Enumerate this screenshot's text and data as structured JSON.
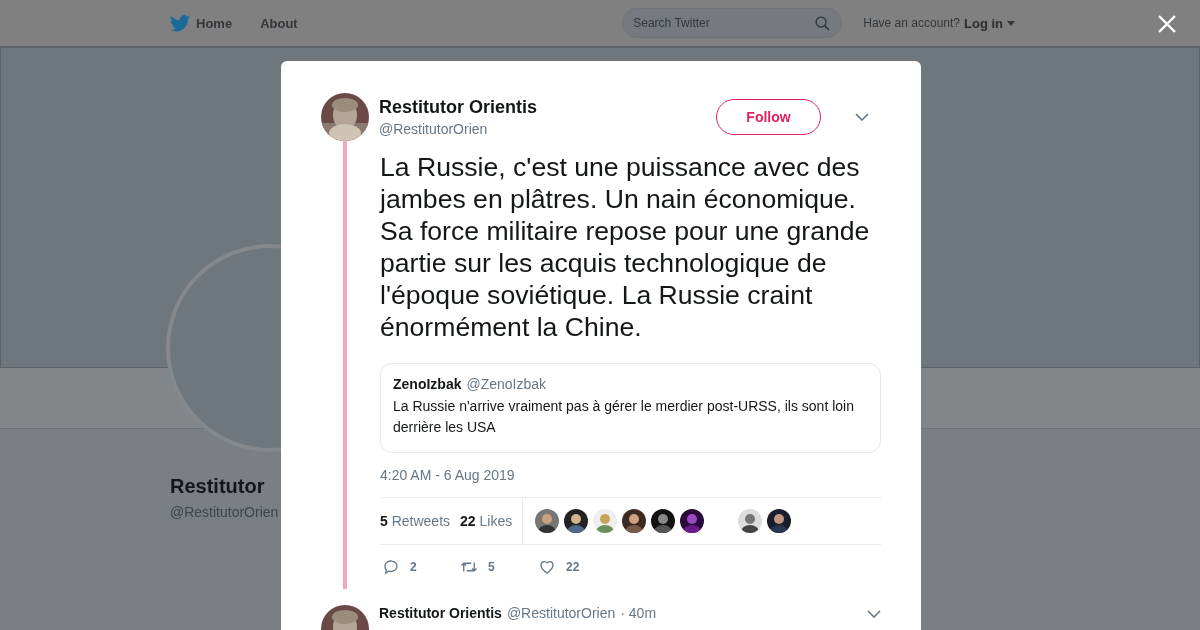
{
  "nav": {
    "items": [
      {
        "label": "Home"
      },
      {
        "label": "About"
      }
    ],
    "search": {
      "placeholder": "Search Twitter"
    },
    "account_prompt": "Have an account?",
    "login": "Log in"
  },
  "profile": {
    "name": "Restitutor",
    "handle": "@RestitutorOrien"
  },
  "tweet": {
    "name": "Restitutor Orientis",
    "handle": "@RestitutorOrien",
    "follow": "Follow",
    "text": "La Russie, c'est une puissance avec des jambes en plâtres. Un nain économique. Sa force militaire repose pour une grande partie sur les acquis technologique de l'époque soviétique. La Russie craint énormément la Chine.",
    "quote": {
      "name": "ZenoIzbak",
      "handle": "@ZenoIzbak",
      "text": "La Russie n'arrive vraiment pas à gérer le merdier post-URSS, ils sont loin derrière les USA"
    },
    "time": "4:20 AM - 6 Aug 2019",
    "stats": [
      {
        "count": "5",
        "label": "Retweets"
      },
      {
        "count": "22",
        "label": "Likes"
      }
    ],
    "liker_avatars": [
      {
        "kind": "picture"
      },
      {
        "kind": "picture"
      },
      {
        "kind": "picture"
      },
      {
        "kind": "picture"
      },
      {
        "kind": "picture"
      },
      {
        "kind": "picture"
      },
      {
        "kind": "blank"
      },
      {
        "kind": "picture"
      },
      {
        "kind": "picture"
      }
    ],
    "actions": [
      {
        "kind": "reply",
        "count": "2"
      },
      {
        "kind": "retweet",
        "count": "5"
      },
      {
        "kind": "like",
        "count": "22"
      }
    ]
  },
  "reply": {
    "name": "Restitutor Orientis",
    "handle": "@RestitutorOrien",
    "time": "· 40m"
  }
}
